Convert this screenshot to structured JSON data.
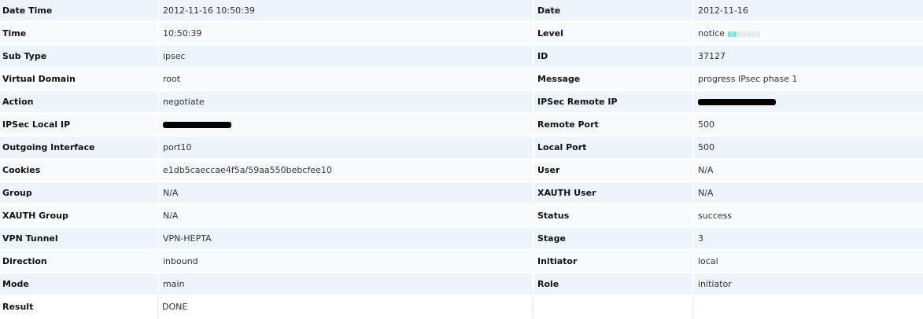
{
  "rows": [
    {
      "l1": "Date Time",
      "v1": "2012-11-16 10:50:39",
      "l2": "Date",
      "v2": "2012-11-16"
    },
    {
      "l1": "Time",
      "v1": "10:50:39",
      "l2": "Level",
      "v2": "notice"
    },
    {
      "l1": "Sub Type",
      "v1": "ipsec",
      "l2": "ID",
      "v2": "37127"
    },
    {
      "l1": "Virtual Domain",
      "v1": "root",
      "l2": "Message",
      "v2": "progress IPsec phase 1"
    },
    {
      "l1": "Action",
      "v1": "negotiate",
      "l2": "IPSec Remote IP",
      "v2": ""
    },
    {
      "l1": "IPSec Local IP",
      "v1": "",
      "l2": "Remote Port",
      "v2": "500"
    },
    {
      "l1": "Outgoing Interface",
      "v1": "port10",
      "l2": "Local Port",
      "v2": "500"
    },
    {
      "l1": "Cookies",
      "v1": "e1db5caeccae4f5a/59aa550bebcfee10",
      "l2": "User",
      "v2": "N/A"
    },
    {
      "l1": "Group",
      "v1": "N/A",
      "l2": "XAUTH User",
      "v2": "N/A"
    },
    {
      "l1": "XAUTH Group",
      "v1": "N/A",
      "l2": "Status",
      "v2": "success"
    },
    {
      "l1": "VPN Tunnel",
      "v1": "VPN-HEPTA",
      "l2": "Stage",
      "v2": "3"
    },
    {
      "l1": "Direction",
      "v1": "inbound",
      "l2": "Initiator",
      "v2": "local"
    },
    {
      "l1": "Mode",
      "v1": "main",
      "l2": "Role",
      "v2": "initiator"
    },
    {
      "l1": "Result",
      "v1": "DONE",
      "l2": "",
      "v2": ""
    }
  ],
  "level_indicator": {
    "active_segments": 2,
    "total_segments": 7,
    "active_color": "#7fe3ee",
    "inactive_color": "#e6e9ee"
  },
  "colors": {
    "row_odd": "#eef4fb",
    "row_even": "#f8fafc",
    "redaction": "#000000"
  }
}
